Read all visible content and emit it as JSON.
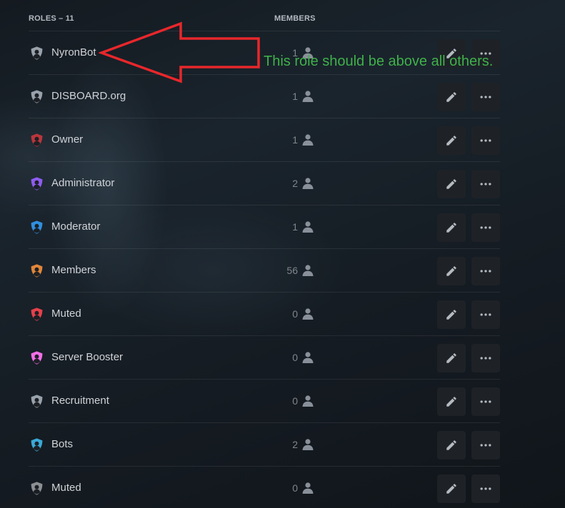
{
  "header": {
    "roles_label": "ROLES – 11",
    "members_label": "MEMBERS"
  },
  "roles": [
    {
      "name": "NyronBot",
      "members": "1",
      "color": "#99a1ab"
    },
    {
      "name": "DISBOARD.org",
      "members": "1",
      "color": "#99a1ab"
    },
    {
      "name": "Owner",
      "members": "1",
      "color": "#b8363c"
    },
    {
      "name": "Administrator",
      "members": "2",
      "color": "#8e5cf0"
    },
    {
      "name": "Moderator",
      "members": "1",
      "color": "#2f8fe0"
    },
    {
      "name": "Members",
      "members": "56",
      "color": "#e0863a"
    },
    {
      "name": "Muted",
      "members": "0",
      "color": "#e6404a"
    },
    {
      "name": "Server Booster",
      "members": "0",
      "color": "#f36ee8"
    },
    {
      "name": "Recruitment",
      "members": "0",
      "color": "#99a1ab"
    },
    {
      "name": "Bots",
      "members": "2",
      "color": "#3aa9d8"
    },
    {
      "name": "Muted",
      "members": "0",
      "color": "#8c8f94"
    }
  ],
  "icons": {
    "role": "shield-person-icon",
    "members": "person-icon",
    "edit": "pencil-icon",
    "more": "ellipsis-icon"
  },
  "annotation": {
    "text": "This role should be above all others.",
    "color": "#3fb14a",
    "arrow_color": "#e8272b"
  }
}
